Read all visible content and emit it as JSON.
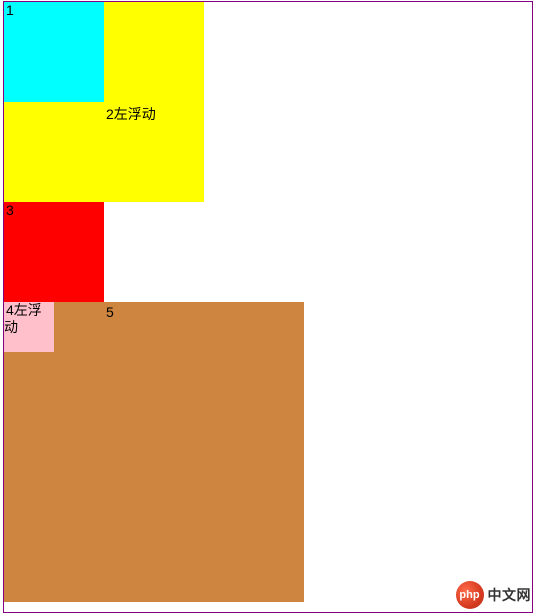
{
  "boxes": {
    "box1": {
      "label": "1"
    },
    "box2": {
      "label": "2左浮动"
    },
    "box3": {
      "label": "3"
    },
    "box4": {
      "label": "4左浮动"
    },
    "box5": {
      "label": "5"
    }
  },
  "logo": {
    "iconText": "php",
    "text": "中文网"
  }
}
